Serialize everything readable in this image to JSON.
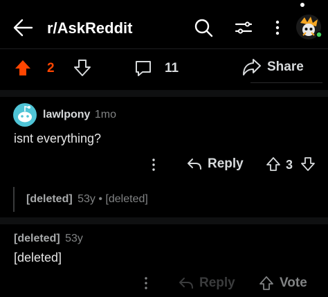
{
  "header": {
    "title": "r/AskReddit",
    "icons": [
      "back-arrow-icon",
      "search-icon",
      "sort-icon",
      "more-vertical-icon",
      "avatar"
    ],
    "online_dot_color": "#46d160"
  },
  "post_actions": {
    "vote_count": "2",
    "comment_count": "11",
    "share_label": "Share",
    "upvote_color": "#ff4500"
  },
  "comments": [
    {
      "username": "lawlpony",
      "age": "1mo",
      "body": "isnt everything?",
      "reply_label": "Reply",
      "score": "3"
    }
  ],
  "collapsed_reply": {
    "author": "[deleted]",
    "age": "53y",
    "separator": "•",
    "body": "[deleted]"
  },
  "deleted_comment": {
    "author": "[deleted]",
    "age": "53y",
    "body": "[deleted]",
    "reply_label": "Reply",
    "vote_label": "Vote"
  }
}
